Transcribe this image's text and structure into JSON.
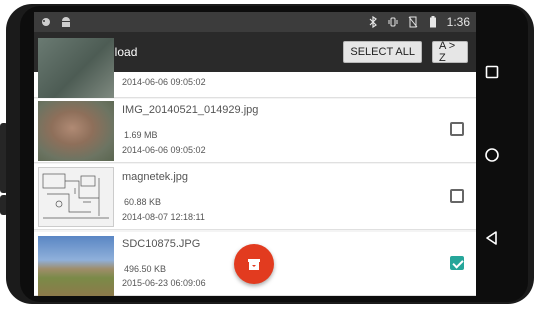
{
  "status_bar": {
    "left_icons": [
      "notification-icon",
      "android-debug-icon"
    ],
    "right_icons": [
      "bluetooth-icon",
      "vibrate-icon",
      "no-sim-icon",
      "battery-icon"
    ],
    "time": "1:36"
  },
  "app_bar": {
    "title": "Download",
    "select_all_label": "SELECT ALL",
    "sort_label": "A > Z"
  },
  "files": [
    {
      "name": "",
      "size": "",
      "date": "2014-06-06 09:05:02",
      "checked": false
    },
    {
      "name": "IMG_20140521_014929.jpg",
      "size": "1.69 MB",
      "date": "2014-06-06 09:05:02",
      "checked": false
    },
    {
      "name": "magnetek.jpg",
      "size": "60.88 KB",
      "date": "2014-08-07 12:18:11",
      "checked": false
    },
    {
      "name": "SDC10875.JPG",
      "size": "496.50 KB",
      "date": "2015-06-23 06:09:06",
      "checked": true
    }
  ],
  "fab": {
    "icon": "archive-box-icon",
    "color": "#e23b1f"
  },
  "nav_bar": {
    "icons": [
      "recents-square-icon",
      "home-circle-icon",
      "back-triangle-icon"
    ]
  },
  "colors": {
    "app_bar": "#2a2a2a",
    "status_bar": "#3c3c3c",
    "checkbox_checked": "#26a69a"
  }
}
